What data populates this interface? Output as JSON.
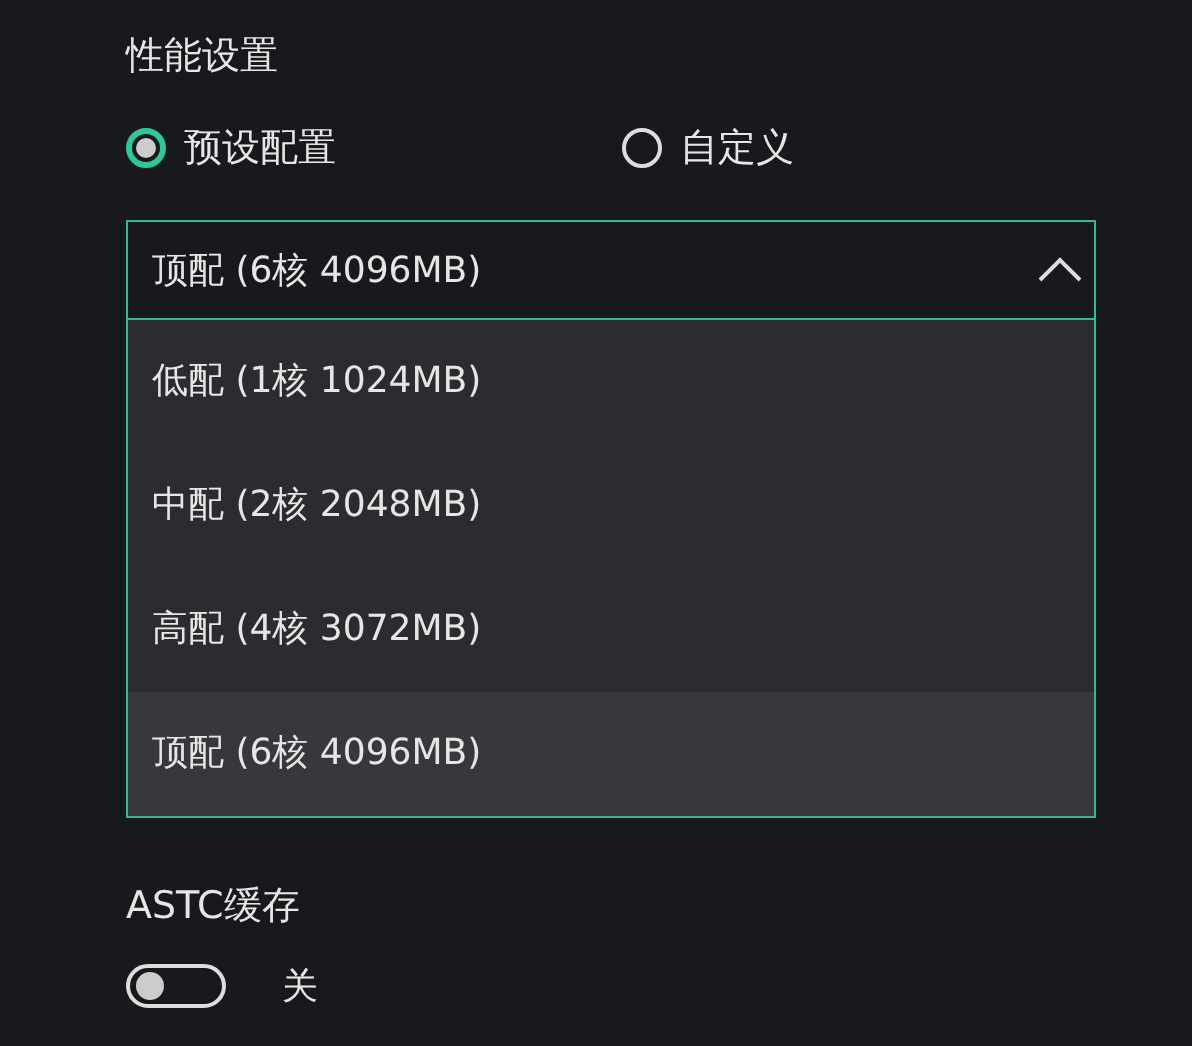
{
  "performance": {
    "title": "性能设置",
    "modes": [
      {
        "label": "预设配置",
        "selected": true
      },
      {
        "label": "自定义",
        "selected": false
      }
    ],
    "dropdown": {
      "value": "顶配 (6核 4096MB)",
      "expanded": true,
      "options": [
        {
          "label": "低配 (1核 1024MB)",
          "selected": false
        },
        {
          "label": "中配 (2核 2048MB)",
          "selected": false
        },
        {
          "label": "高配 (4核 3072MB)",
          "selected": false
        },
        {
          "label": "顶配 (6核 4096MB)",
          "selected": true
        }
      ]
    }
  },
  "astc": {
    "title": "ASTC缓存",
    "on": false,
    "state_label": "关"
  }
}
